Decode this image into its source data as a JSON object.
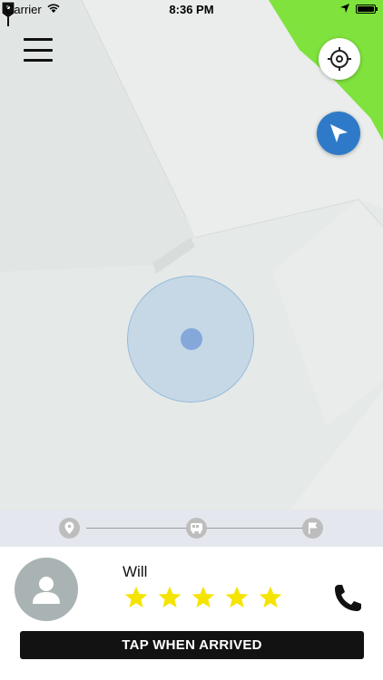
{
  "status_bar": {
    "carrier": "Carrier",
    "time": "8:36 PM",
    "icons": [
      "wifi-icon",
      "location-arrow-icon",
      "battery-icon"
    ]
  },
  "map": {
    "background_color": "#e5e9e8",
    "park_color": "#7fe23d",
    "accuracy_color": "#a0c4e2",
    "controls": {
      "menu_icon": "hamburger-icon",
      "locate_icon": "crosshair-icon",
      "navigate_icon": "navigation-arrow-icon",
      "navigate_color": "#2f7ac8"
    }
  },
  "trip_progress": {
    "steps": [
      {
        "icon": "map-pin-icon"
      },
      {
        "icon": "bus-icon"
      },
      {
        "icon": "finish-flag-icon"
      }
    ]
  },
  "driver": {
    "name": "Will",
    "rating": 5,
    "rating_max": 5,
    "star_color": "#f5e400",
    "avatar_icon": "person-silhouette-icon",
    "call_icon": "phone-icon"
  },
  "action": {
    "label": "TAP WHEN ARRIVED"
  }
}
